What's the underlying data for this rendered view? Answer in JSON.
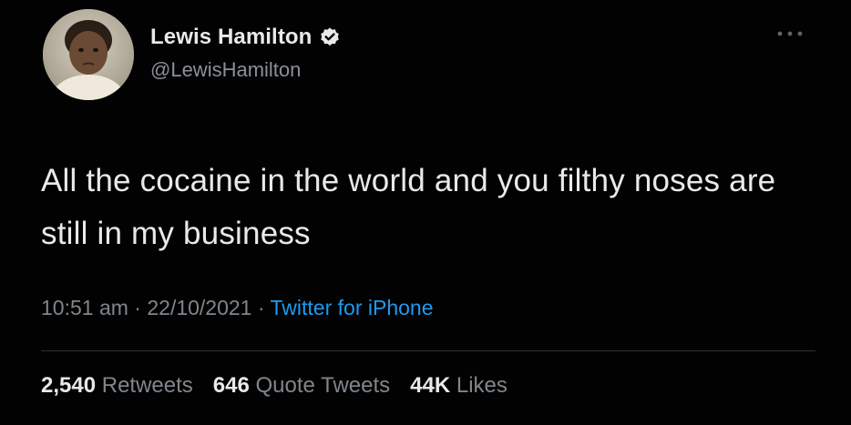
{
  "author": {
    "display_name": "Lewis Hamilton",
    "handle": "@LewisHamilton",
    "verified": true,
    "avatar_icon": "avatar-photo"
  },
  "tweet": {
    "text": "All the cocaine in the world and you filthy noses are still in my business",
    "time": "10:51 am",
    "separator": "·",
    "date": "22/10/2021",
    "source": "Twitter for iPhone"
  },
  "stats": {
    "retweets_count": "2,540",
    "retweets_label": "Retweets",
    "quote_count": "646",
    "quote_label": "Quote Tweets",
    "likes_count": "44K",
    "likes_label": "Likes"
  },
  "colors": {
    "background": "#020202",
    "text_primary": "#e7e9ea",
    "text_secondary": "#80868b",
    "link": "#1d9bf0",
    "divider": "#2f3336"
  },
  "icons": {
    "verified": "verified-badge-icon",
    "more": "more-options-icon"
  }
}
